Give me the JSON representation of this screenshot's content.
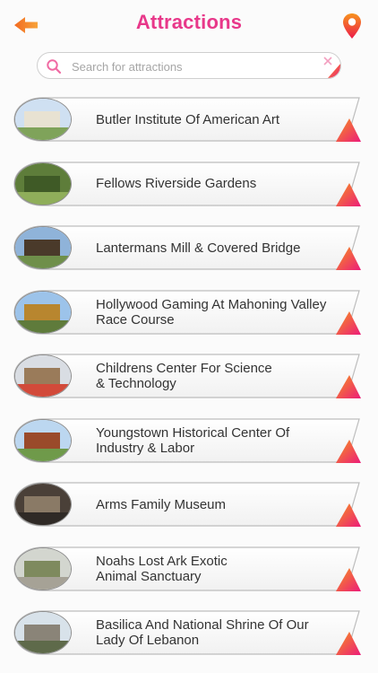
{
  "header": {
    "title": "Attractions",
    "title_color": "#e8388a",
    "accent_gradient": [
      "#f7931e",
      "#ec1c7a"
    ],
    "back_icon": "back-arrow-icon",
    "location_icon": "map-pin-icon"
  },
  "search": {
    "placeholder": "Search for attractions",
    "value": ""
  },
  "attractions": [
    {
      "label": "Butler Institute Of American Art",
      "image": "butler-institute-photo"
    },
    {
      "label": "Fellows Riverside Gardens",
      "image": "fellows-riverside-gardens-photo"
    },
    {
      "label": "Lantermans Mill & Covered Bridge",
      "image": "lantermans-mill-photo"
    },
    {
      "label": "Hollywood Gaming At Mahoning Valley\nRace Course",
      "image": "hollywood-gaming-photo"
    },
    {
      "label": "Childrens Center For Science\n& Technology",
      "image": "childrens-center-photo"
    },
    {
      "label": "Youngstown Historical Center Of\nIndustry & Labor",
      "image": "youngstown-historical-center-photo"
    },
    {
      "label": "Arms Family Museum",
      "image": "arms-family-museum-photo"
    },
    {
      "label": "Noahs Lost Ark Exotic\nAnimal Sanctuary",
      "image": "noahs-lost-ark-photo"
    },
    {
      "label": "Basilica And National Shrine Of Our\nLady Of Lebanon",
      "image": "basilica-shrine-photo"
    }
  ]
}
